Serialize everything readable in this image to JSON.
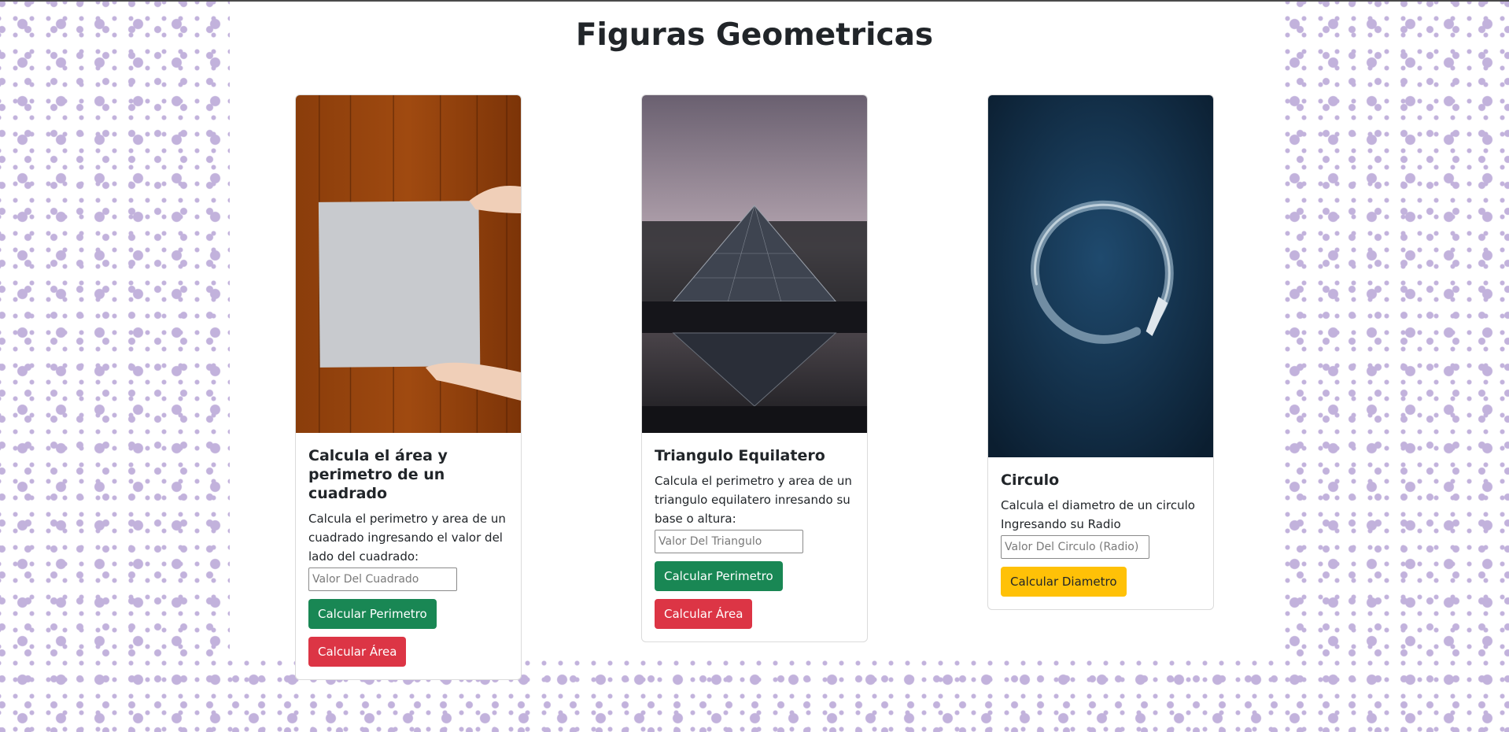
{
  "page": {
    "title": "Figuras Geometricas"
  },
  "cards": {
    "square": {
      "title": "Calcula el área y perimetro de un cuadrado",
      "text": "Calcula el perimetro y area de un cuadrado ingresando el valor del lado del cuadrado:",
      "input_placeholder": "Valor Del Cuadrado",
      "input_value": "",
      "perimeter_button": "Calcular Perimetro",
      "area_button": "Calcular Área"
    },
    "triangle": {
      "title": "Triangulo Equilatero",
      "text": "Calcula el perimetro y area de un triangulo equilatero inresando su base o altura:",
      "input_placeholder": "Valor Del Triangulo",
      "input_value": "",
      "perimeter_button": "Calcular Perimetro",
      "area_button": "Calcular Área"
    },
    "circle": {
      "title": "Circulo",
      "text": "Calcula el diametro de un circulo Ingresando su Radio",
      "input_placeholder": "Valor Del Circulo (Radio)",
      "input_value": "",
      "diameter_button": "Calcular Diametro"
    }
  },
  "colors": {
    "success": "#198754",
    "danger": "#dc3545",
    "warning": "#ffc107",
    "pattern_dots": "#c2b2dc"
  }
}
